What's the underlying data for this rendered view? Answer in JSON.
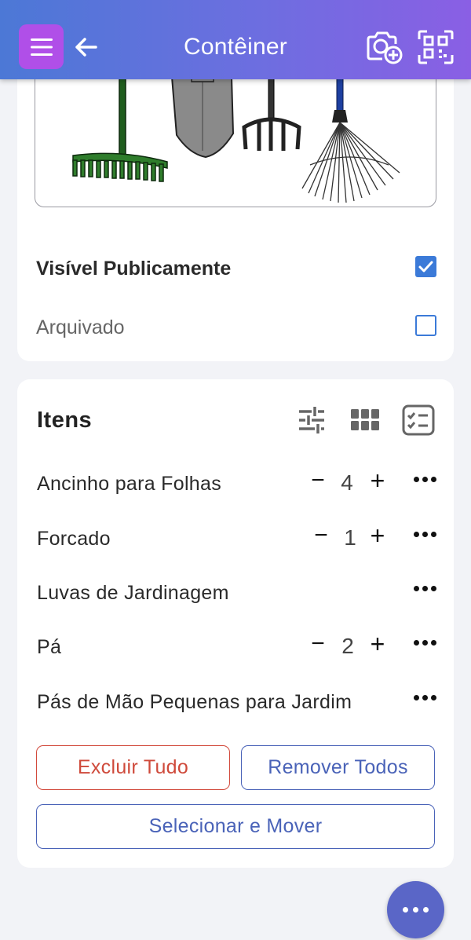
{
  "header": {
    "title": "Contêiner",
    "icons": [
      "menu-icon",
      "back-arrow-icon",
      "add-photo-icon",
      "qr-scan-icon"
    ]
  },
  "container": {
    "image_subject": "garden tools: leaf rake, shovel, pitchfork, fan rake",
    "visible_publicly": {
      "label": "Visível Publicamente",
      "checked": true
    },
    "archived": {
      "label": "Arquivado",
      "checked": false
    }
  },
  "items_card": {
    "title": "Itens",
    "toolbar_icons": [
      "filter-sliders-icon",
      "grid-view-icon",
      "checklist-icon"
    ],
    "items": [
      {
        "name": "Ancinho para Folhas",
        "quantity": "4",
        "minus": "−",
        "plus": "+"
      },
      {
        "name": "Forcado",
        "quantity": "1",
        "minus": "−",
        "plus": "+"
      },
      {
        "name": "Luvas de Jardinagem"
      },
      {
        "name": "Pá",
        "quantity": "2",
        "minus": "−",
        "plus": "+"
      },
      {
        "name": "Pás de Mão Pequenas para Jardim"
      }
    ],
    "buttons": {
      "delete_all": "Excluir Tudo",
      "remove_all": "Remover Todos",
      "select_move": "Selecionar e Mover"
    }
  },
  "colors": {
    "header_gradient": [
      "#4c78d6",
      "#8a5fe4"
    ],
    "menu_button": "#b04fe8",
    "checkbox": "#3b7ad8",
    "danger": "#cf4a3b",
    "primary": "#4a63b8",
    "fab": "#5a66c7"
  }
}
